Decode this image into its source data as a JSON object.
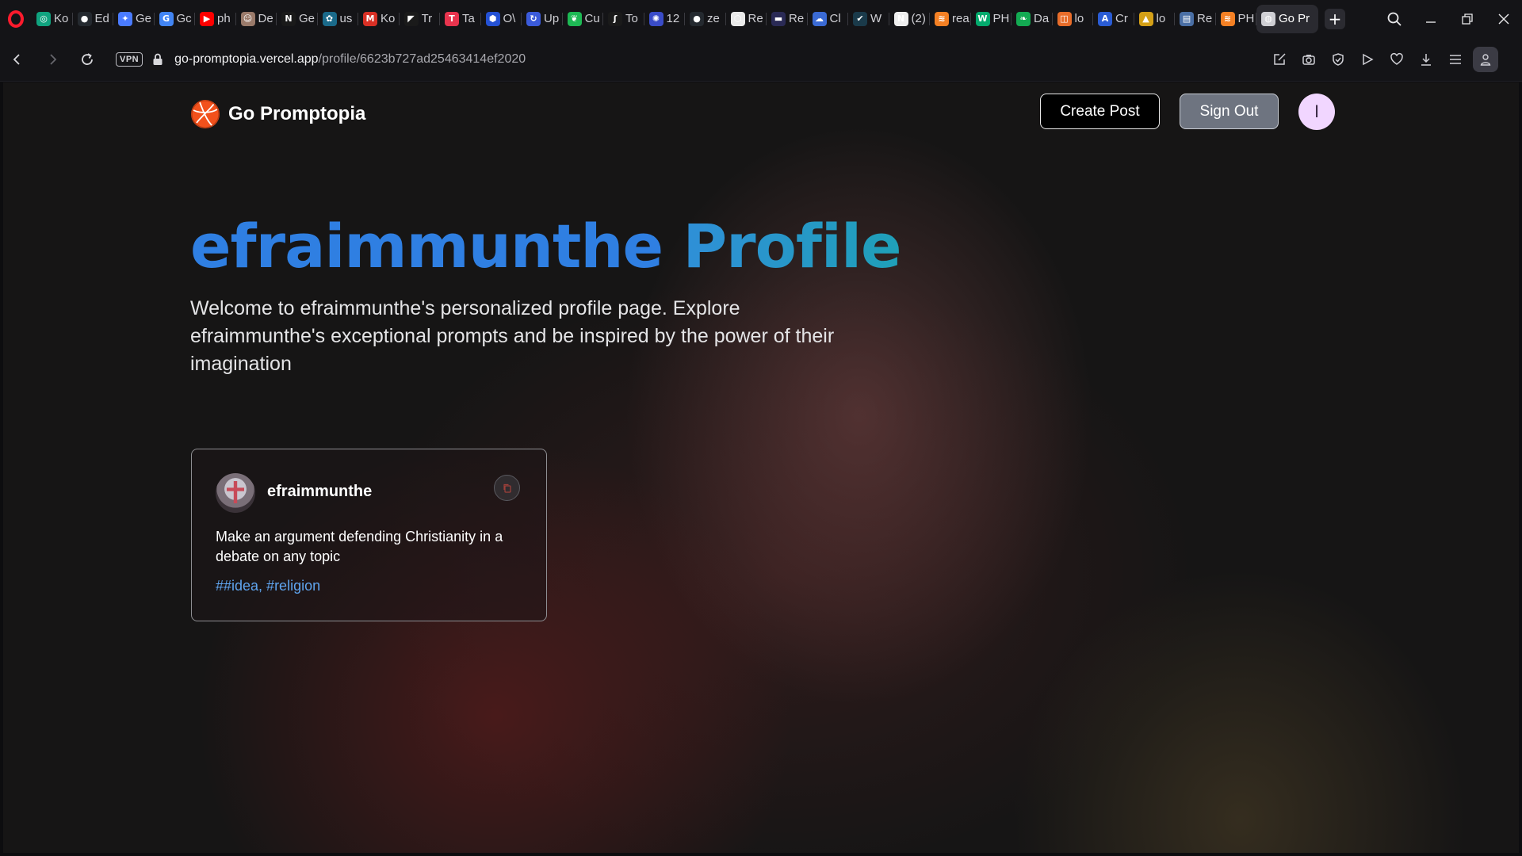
{
  "browser": {
    "tabs": [
      {
        "title": "Ko",
        "favicon": "chatgpt-icon",
        "color": "#10a37f",
        "glyph": "◎"
      },
      {
        "title": "Ed",
        "favicon": "github-icon",
        "color": "#24292f",
        "glyph": "●"
      },
      {
        "title": "Ge",
        "favicon": "gemini-icon",
        "color": "#4a7bff",
        "glyph": "✦"
      },
      {
        "title": "Gc",
        "favicon": "google-translate-icon",
        "color": "#4285f4",
        "glyph": "G"
      },
      {
        "title": "ph",
        "favicon": "youtube-icon",
        "color": "#ff0000",
        "glyph": "▶"
      },
      {
        "title": "De",
        "favicon": "person-avatar-icon",
        "color": "#9a7a6a",
        "glyph": "☺"
      },
      {
        "title": "Ge",
        "favicon": "notion-n-icon",
        "color": "#1a1a1a",
        "glyph": "N"
      },
      {
        "title": "us",
        "favicon": "openai-icon",
        "color": "#1a6a8a",
        "glyph": "✿"
      },
      {
        "title": "Ko",
        "favicon": "gmail-icon",
        "color": "#d93025",
        "glyph": "M"
      },
      {
        "title": "Tr",
        "favicon": "framer-icon",
        "color": "#1a1a1a",
        "glyph": "◤"
      },
      {
        "title": "Ta",
        "favicon": "t-app-icon",
        "color": "#e8344e",
        "glyph": "T"
      },
      {
        "title": "O\\",
        "favicon": "shield-app-icon",
        "color": "#2451d4",
        "glyph": "⬢"
      },
      {
        "title": "Up",
        "favicon": "refresh-app-icon",
        "color": "#3b5bdb",
        "glyph": "↻"
      },
      {
        "title": "Cu",
        "favicon": "leaf-app-icon",
        "color": "#1db954",
        "glyph": "❦"
      },
      {
        "title": "To",
        "favicon": "pen-app-icon",
        "color": "#1a1a1a",
        "glyph": "ʃ"
      },
      {
        "title": "12",
        "favicon": "globe-app-icon",
        "color": "#3a4cc8",
        "glyph": "✺"
      },
      {
        "title": "ze",
        "favicon": "github-icon",
        "color": "#24292f",
        "glyph": "●"
      },
      {
        "title": "Re",
        "favicon": "hexagon-app-icon",
        "color": "#eaeaea",
        "glyph": "⬡"
      },
      {
        "title": "Re",
        "favicon": "dark-app-icon",
        "color": "#2a2a55",
        "glyph": "▬"
      },
      {
        "title": "Cl",
        "favicon": "cloud-app-icon",
        "color": "#3a6ad4",
        "glyph": "☁"
      },
      {
        "title": "W",
        "favicon": "check-app-icon",
        "color": "#1a3a4a",
        "glyph": "✔"
      },
      {
        "title": "(2)",
        "favicon": "notion-icon",
        "color": "#eeeeee",
        "glyph": "N"
      },
      {
        "title": "rea",
        "favicon": "stack-app-icon",
        "color": "#f48024",
        "glyph": "≋"
      },
      {
        "title": "PH",
        "favicon": "w3-app-icon",
        "color": "#04aa6d",
        "glyph": "W"
      },
      {
        "title": "Da",
        "favicon": "mongodb-leaf-icon",
        "color": "#13aa52",
        "glyph": "❧"
      },
      {
        "title": "lo",
        "favicon": "html-app-icon",
        "color": "#e86d2a",
        "glyph": "◫"
      },
      {
        "title": "Cr",
        "favicon": "api-app-icon",
        "color": "#2a5cd4",
        "glyph": "A"
      },
      {
        "title": "lo",
        "favicon": "triangle-app-icon",
        "color": "#d4a017",
        "glyph": "▲"
      },
      {
        "title": "Re",
        "favicon": "book-app-icon",
        "color": "#4a6fa5",
        "glyph": "▤"
      },
      {
        "title": "PH",
        "favicon": "stack-app-icon",
        "color": "#f48024",
        "glyph": "≋"
      },
      {
        "title": "Go Pr",
        "favicon": "globe-icon",
        "color": "#cfcfd4",
        "glyph": "◍",
        "active": true
      }
    ],
    "new_tab_label": "+",
    "url_domain": "go-promptopia.vercel.app",
    "url_path": "/profile/6623b727ad25463414ef2020",
    "vpn_label": "VPN"
  },
  "site": {
    "brand_name": "Go Promptopia",
    "create_post_label": "Create Post",
    "sign_out_label": "Sign Out",
    "avatar_initial": "I",
    "accent_blue": "#2f7fe2"
  },
  "profile": {
    "title_name": "efraimmunthe",
    "title_suffix": "Profile",
    "description": "Welcome to efraimmunthe's personalized profile page. Explore efraimmunthe's exceptional prompts and be inspired by the power of their imagination"
  },
  "posts": [
    {
      "username": "efraimmunthe",
      "prompt": "Make an argument defending Christianity in a debate on any topic",
      "tags": "##idea, #religion"
    }
  ]
}
